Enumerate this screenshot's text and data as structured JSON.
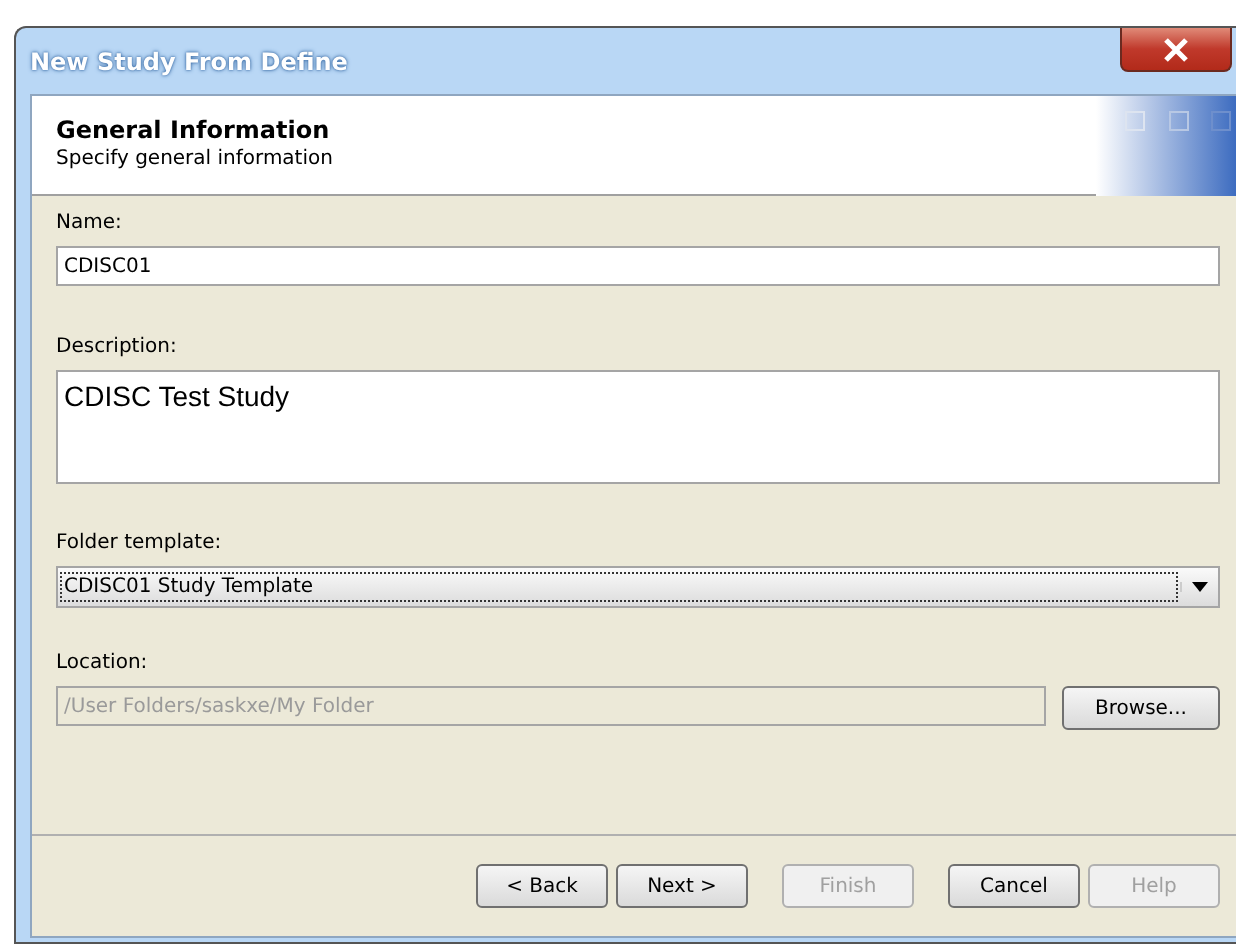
{
  "window": {
    "title": "New Study From Define"
  },
  "header": {
    "title": "General Information",
    "subtitle": "Specify general information"
  },
  "fields": [
    {
      "kind": "text",
      "label": "Name:",
      "value": "CDISC01",
      "disabled": false
    },
    {
      "kind": "textarea",
      "label": "Description:",
      "value": "CDISC Test Study",
      "disabled": false
    },
    {
      "kind": "combo",
      "label": "Folder template:",
      "value": "CDISC01 Study Template",
      "disabled": false
    },
    {
      "kind": "browse",
      "label": "Location:",
      "value": "/User Folders/saskxe/My Folder",
      "disabled": true,
      "button": "Browse..."
    }
  ],
  "buttons": [
    {
      "label": "< Back",
      "disabled": false
    },
    {
      "label": "Next >",
      "disabled": false
    },
    {
      "label": "Finish",
      "disabled": true
    },
    {
      "label": "Cancel",
      "disabled": false
    },
    {
      "label": "Help",
      "disabled": true
    }
  ]
}
